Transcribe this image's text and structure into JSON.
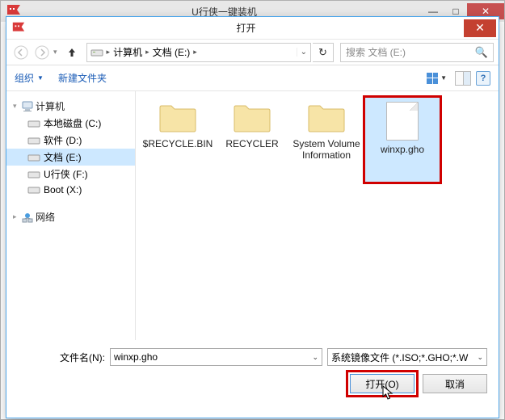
{
  "parent": {
    "title": "U行侠一键装机"
  },
  "dialog": {
    "title": "打开"
  },
  "breadcrumb": {
    "root": "计算机",
    "current": "文档 (E:)"
  },
  "search": {
    "placeholder": "搜索 文档 (E:)"
  },
  "toolbar": {
    "organize": "组织",
    "new_folder": "新建文件夹"
  },
  "tree": {
    "computer": "计算机",
    "drives": [
      {
        "label": "本地磁盘 (C:)"
      },
      {
        "label": "软件 (D:)"
      },
      {
        "label": "文档 (E:)"
      },
      {
        "label": "U行侠 (F:)"
      },
      {
        "label": "Boot (X:)"
      }
    ],
    "network": "网络"
  },
  "files": [
    {
      "name": "$RECYCLE.BIN",
      "type": "folder"
    },
    {
      "name": "RECYCLER",
      "type": "folder"
    },
    {
      "name": "System Volume Information",
      "type": "folder"
    },
    {
      "name": "winxp.gho",
      "type": "file",
      "selected": true,
      "highlighted": true
    }
  ],
  "bottom": {
    "filename_label": "文件名(N):",
    "filename_value": "winxp.gho",
    "filter": "系统镜像文件 (*.ISO;*.GHO;*.W",
    "open": "打开(O)",
    "cancel": "取消"
  }
}
